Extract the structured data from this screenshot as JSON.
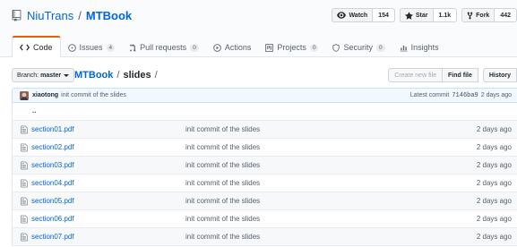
{
  "repo": {
    "owner": "NiuTrans",
    "separator": "/",
    "name": "MTBook"
  },
  "actions": {
    "watch_label": "Watch",
    "watch_count": "154",
    "star_label": "Star",
    "star_count": "1.1k",
    "fork_label": "Fork",
    "fork_count": "442"
  },
  "tabs": [
    {
      "label": "Code",
      "icon": "code-icon"
    },
    {
      "label": "Issues",
      "count": "4",
      "icon": "issue-icon"
    },
    {
      "label": "Pull requests",
      "count": "0",
      "icon": "pull-request-icon"
    },
    {
      "label": "Actions",
      "icon": "actions-play-icon"
    },
    {
      "label": "Projects",
      "count": "0",
      "icon": "project-icon"
    },
    {
      "label": "Security",
      "count": "0",
      "icon": "shield-icon"
    },
    {
      "label": "Insights",
      "icon": "graph-icon"
    }
  ],
  "filenav": {
    "branch_prefix": "Branch:",
    "branch": "master",
    "path_root": "MTBook",
    "path_sep": "/",
    "path_dir": "slides",
    "path_trail": "/",
    "create_new_file": "Create new file",
    "find_file": "Find file",
    "history": "History"
  },
  "commit": {
    "author": "xiaotong",
    "message": "init commit of the slides",
    "latest_label": "Latest commit",
    "sha": "7146ba9",
    "age": "2 days ago"
  },
  "files": {
    "parent": "..",
    "rows": [
      {
        "name": "section01.pdf",
        "message": "init commit of the slides",
        "age": "2 days ago"
      },
      {
        "name": "section02.pdf",
        "message": "init commit of the slides",
        "age": "2 days ago"
      },
      {
        "name": "section03.pdf",
        "message": "init commit of the slides",
        "age": "2 days ago"
      },
      {
        "name": "section04.pdf",
        "message": "init commit of the slides",
        "age": "2 days ago"
      },
      {
        "name": "section05.pdf",
        "message": "init commit of the slides",
        "age": "2 days ago"
      },
      {
        "name": "section06.pdf",
        "message": "init commit of the slides",
        "age": "2 days ago"
      },
      {
        "name": "section07.pdf",
        "message": "init commit of the slides",
        "age": "2 days ago"
      }
    ]
  },
  "colors": {
    "link": "#0366d6",
    "tab_accent": "#e36209",
    "commit_bg": "#f1f8ff"
  }
}
